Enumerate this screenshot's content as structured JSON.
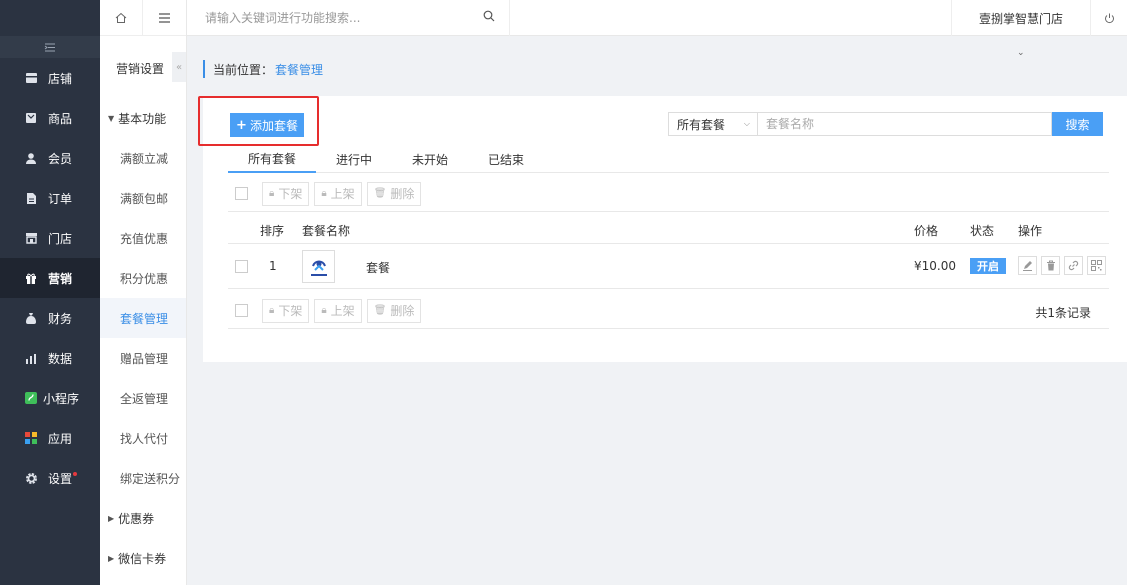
{
  "topbar": {
    "search_placeholder": "请输入关键词进行功能搜索...",
    "store_name": "壹捌掌智慧门店"
  },
  "sidebar": {
    "items": [
      {
        "label": "店铺",
        "icon": "store-icon"
      },
      {
        "label": "商品",
        "icon": "goods-icon"
      },
      {
        "label": "会员",
        "icon": "member-icon"
      },
      {
        "label": "订单",
        "icon": "order-icon"
      },
      {
        "label": "门店",
        "icon": "shop-icon"
      },
      {
        "label": "营销",
        "icon": "gift-icon"
      },
      {
        "label": "财务",
        "icon": "finance-icon"
      },
      {
        "label": "数据",
        "icon": "data-icon"
      },
      {
        "label": "小程序",
        "icon": "miniapp-icon"
      },
      {
        "label": "应用",
        "icon": "apps-icon"
      },
      {
        "label": "设置",
        "icon": "gear-icon"
      }
    ],
    "active_index": 5
  },
  "subnav": {
    "title": "营销设置",
    "group_basic": "基本功能",
    "items": [
      "满额立减",
      "满额包邮",
      "充值优惠",
      "积分优惠",
      "套餐管理",
      "赠品管理",
      "全返管理",
      "找人代付",
      "绑定送积分"
    ],
    "active_item": "套餐管理",
    "group_coupon": "优惠券",
    "group_wechat": "微信卡券"
  },
  "breadcrumb": {
    "prefix": "当前位置：",
    "current": "套餐管理"
  },
  "main": {
    "add_button": "添加套餐",
    "filter_selected": "所有套餐",
    "name_placeholder": "套餐名称",
    "search_button": "搜索",
    "tabs": [
      "所有套餐",
      "进行中",
      "未开始",
      "已结束"
    ],
    "active_tab": "所有套餐",
    "toolbar": {
      "offline": "下架",
      "online": "上架",
      "delete": "删除"
    },
    "columns": {
      "order": "排序",
      "name": "套餐名称",
      "price": "价格",
      "status": "状态",
      "ops": "操作"
    },
    "rows": [
      {
        "order": "1",
        "name": "套餐",
        "price": "¥10.00",
        "status": "开启"
      }
    ],
    "total": "共1条记录"
  },
  "colors": {
    "accent": "#4a9ff5",
    "sidebar_bg": "#2b3341",
    "highlight": "#e62d2d"
  }
}
